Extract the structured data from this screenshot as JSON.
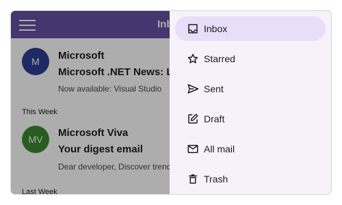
{
  "app_bar": {
    "title": "Inbox"
  },
  "mails": [
    {
      "avatar": "M",
      "avatar_color": "#2d3e94",
      "sender": "Microsoft",
      "subject": "Microsoft .NET News: Learn",
      "preview": "Now available: Visual Studio"
    },
    {
      "avatar": "MV",
      "avatar_color": "#3a8a2e",
      "sender": "Microsoft Viva",
      "subject": "Your digest email",
      "preview": "Dear developer, Discover trends"
    }
  ],
  "sections": {
    "this_week": "This Week",
    "last_week": "Last Week"
  },
  "drawer": {
    "items": [
      {
        "label": "Inbox",
        "icon": "inbox-icon",
        "selected": true
      },
      {
        "label": "Starred",
        "icon": "star-icon",
        "selected": false
      },
      {
        "label": "Sent",
        "icon": "send-icon",
        "selected": false
      },
      {
        "label": "Draft",
        "icon": "draft-icon",
        "selected": false
      },
      {
        "label": "All mail",
        "icon": "mail-icon",
        "selected": false
      },
      {
        "label": "Trash",
        "icon": "trash-icon",
        "selected": false
      }
    ]
  },
  "colors": {
    "app_bar": "#6650a4",
    "drawer_bg": "#f7f2fa",
    "selected_item": "#e8def8"
  }
}
